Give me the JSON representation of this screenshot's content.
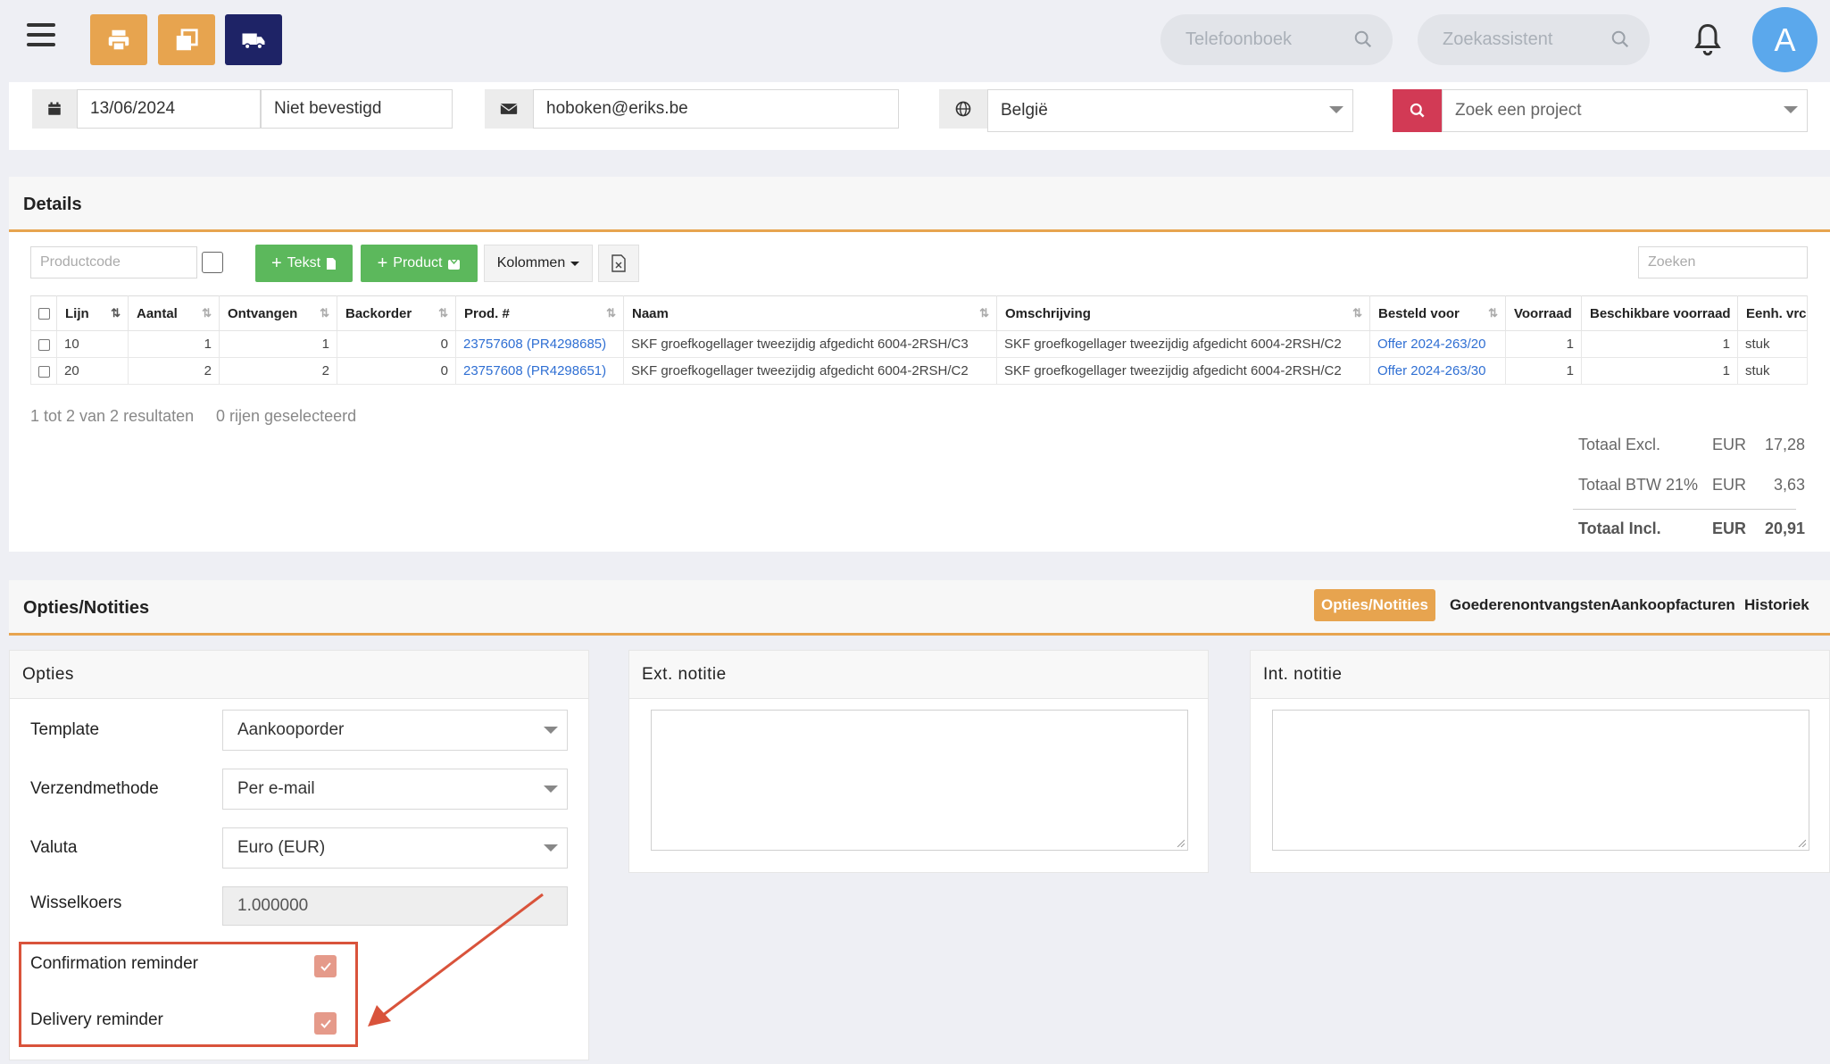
{
  "topbar": {
    "search_phonebook": "Telefoonboek",
    "search_assistant": "Zoekassistent",
    "avatar_letter": "A",
    "colors": {
      "orange": "#e7a44f",
      "navy": "#1e2366",
      "avatar": "#5ba8ec"
    }
  },
  "header": {
    "date": "13/06/2024",
    "status": "Niet bevestigd",
    "email": "hoboken@eriks.be",
    "country": "België",
    "project_placeholder": "Zoek een project"
  },
  "details": {
    "title": "Details",
    "productcode_placeholder": "Productcode",
    "btn_text": "Tekst",
    "btn_product": "Product",
    "btn_columns": "Kolommen",
    "search_placeholder": "Zoeken",
    "columns": [
      "Lijn",
      "Aantal",
      "Ontvangen",
      "Backorder",
      "Prod. #",
      "Naam",
      "Omschrijving",
      "Besteld voor",
      "Voorraad",
      "Beschikbare voorraad",
      "Eenh. vrc"
    ],
    "rows": [
      {
        "lijn": "10",
        "aantal": "1",
        "ontvangen": "1",
        "backorder": "0",
        "prod": "23757608 (PR4298685)",
        "naam": "SKF groefkogellager tweezijdig afgedicht 6004-2RSH/C3",
        "omschrijving": "SKF groefkogellager tweezijdig afgedicht 6004-2RSH/C2",
        "besteld": "Offer 2024-263/20",
        "voorraad": "1",
        "beschikbaar": "1",
        "eenheid": "stuk"
      },
      {
        "lijn": "20",
        "aantal": "2",
        "ontvangen": "2",
        "backorder": "0",
        "prod": "23757608 (PR4298651)",
        "naam": "SKF groefkogellager tweezijdig afgedicht 6004-2RSH/C2",
        "omschrijving": "SKF groefkogellager tweezijdig afgedicht 6004-2RSH/C2",
        "besteld": "Offer 2024-263/30",
        "voorraad": "1",
        "beschikbaar": "1",
        "eenheid": "stuk"
      }
    ],
    "result_count": "1 tot 2 van 2 resultaten",
    "selected_count": "0 rijen geselecteerd",
    "totals": {
      "excl_label": "Totaal Excl.",
      "excl_cur": "EUR",
      "excl_val": "17,28",
      "btw_label": "Totaal BTW 21%",
      "btw_cur": "EUR",
      "btw_val": "3,63",
      "incl_label": "Totaal Incl.",
      "incl_cur": "EUR",
      "incl_val": "20,91"
    }
  },
  "options_section": {
    "title": "Opties/Notities",
    "tabs": [
      "Opties/Notities",
      "Goederenontvangsten",
      "Aankoopfacturen",
      "Historiek"
    ],
    "opties": {
      "title": "Opties",
      "template_label": "Template",
      "template_value": "Aankooporder",
      "verzend_label": "Verzendmethode",
      "verzend_value": "Per e-mail",
      "valuta_label": "Valuta",
      "valuta_value": "Euro (EUR)",
      "wissel_label": "Wisselkoers",
      "wissel_value": "1.000000",
      "confirmation_label": "Confirmation reminder",
      "delivery_label": "Delivery reminder"
    },
    "ext_title": "Ext. notitie",
    "int_title": "Int. notitie"
  },
  "annotation_color": "#d9533b"
}
